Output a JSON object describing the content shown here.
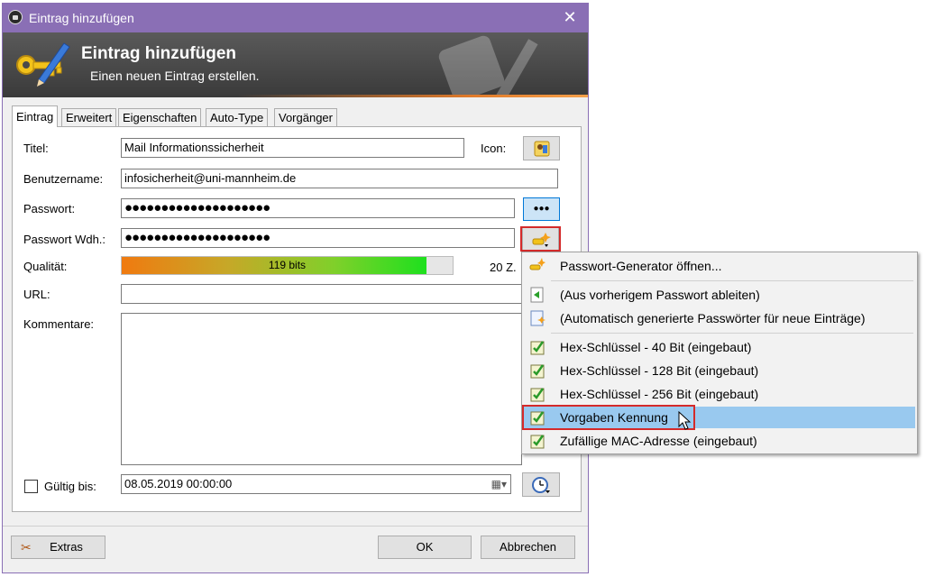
{
  "window": {
    "title": "Eintrag hinzufügen",
    "close_glyph": "✕"
  },
  "banner": {
    "title": "Eintrag hinzufügen",
    "subtitle": "Einen neuen Eintrag erstellen."
  },
  "tabs": [
    {
      "label": "Eintrag",
      "active": true
    },
    {
      "label": "Erweitert",
      "active": false
    },
    {
      "label": "Eigenschaften",
      "active": false
    },
    {
      "label": "Auto-Type",
      "active": false
    },
    {
      "label": "Vorgänger",
      "active": false
    }
  ],
  "form": {
    "title_label": "Titel:",
    "title_value": "Mail Informationssicherheit",
    "icon_label": "Icon:",
    "username_label": "Benutzername:",
    "username_value": "infosicherheit@uni-mannheim.de",
    "password_label": "Passwort:",
    "password_value": "●●●●●●●●●●●●●●●●●●●●",
    "password_repeat_label": "Passwort Wdh.:",
    "password_repeat_value": "●●●●●●●●●●●●●●●●●●●●",
    "show_password_glyph": "●●●",
    "quality_label": "Qualität:",
    "quality_text": "119 bits",
    "quality_fraction": 0.92,
    "char_count": "20 Z.",
    "url_label": "URL:",
    "url_value": "",
    "comments_label": "Kommentare:",
    "comments_value": "",
    "expires_label": "Gültig bis:",
    "expires_checked": false,
    "expires_value": "08.05.2019 00:00:00"
  },
  "footer": {
    "extras_label": "Extras",
    "ok_label": "OK",
    "cancel_label": "Abbrechen"
  },
  "menu": {
    "items": [
      {
        "label": "Passwort-Generator öffnen...",
        "icon": "generator-icon",
        "highlighted": false
      },
      {
        "label": "(Aus vorherigem Passwort ableiten)",
        "icon": "derive-icon",
        "highlighted": false
      },
      {
        "label": "(Automatisch generierte Passwörter für neue Einträge)",
        "icon": "auto-generate-icon",
        "highlighted": false
      },
      {
        "label": "Hex-Schlüssel - 40 Bit (eingebaut)",
        "icon": "profile-icon",
        "highlighted": false
      },
      {
        "label": "Hex-Schlüssel - 128 Bit (eingebaut)",
        "icon": "profile-icon",
        "highlighted": false
      },
      {
        "label": "Hex-Schlüssel - 256 Bit (eingebaut)",
        "icon": "profile-icon",
        "highlighted": false
      },
      {
        "label": "Vorgaben Kennung",
        "icon": "profile-icon",
        "highlighted": true
      },
      {
        "label": "Zufällige MAC-Adresse (eingebaut)",
        "icon": "profile-icon",
        "highlighted": false
      }
    ]
  },
  "colors": {
    "titlebar": "#8a6fb5",
    "highlight": "#99c9ef",
    "annotation_red": "#d42a2a"
  }
}
